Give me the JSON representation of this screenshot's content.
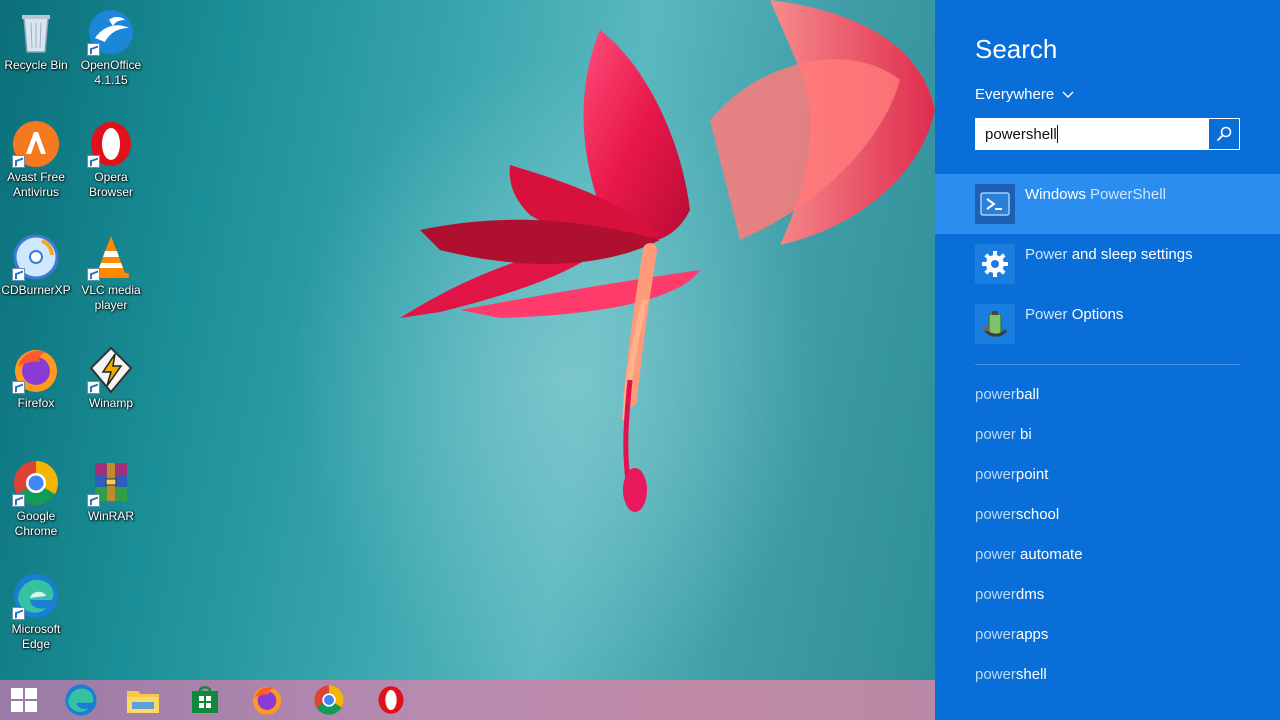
{
  "desktop": {
    "icons": [
      {
        "label_1": "Recycle Bin",
        "label_2": "",
        "icon": "recycle-bin-icon"
      },
      {
        "label_1": "OpenOffice",
        "label_2": "4.1.15",
        "icon": "openoffice-icon"
      },
      {
        "label_1": "Avast Free",
        "label_2": "Antivirus",
        "icon": "avast-icon"
      },
      {
        "label_1": "Opera",
        "label_2": "Browser",
        "icon": "opera-icon"
      },
      {
        "label_1": "CDBurnerXP",
        "label_2": "",
        "icon": "cdburnerxp-icon"
      },
      {
        "label_1": "VLC media",
        "label_2": "player",
        "icon": "vlc-icon"
      },
      {
        "label_1": "Firefox",
        "label_2": "",
        "icon": "firefox-icon"
      },
      {
        "label_1": "Winamp",
        "label_2": "",
        "icon": "winamp-icon"
      },
      {
        "label_1": "Google",
        "label_2": "Chrome",
        "icon": "chrome-icon"
      },
      {
        "label_1": "WinRAR",
        "label_2": "",
        "icon": "winrar-icon"
      },
      {
        "label_1": "Microsoft",
        "label_2": "Edge",
        "icon": "edge-icon"
      }
    ]
  },
  "taskbar": {
    "items": [
      "start-icon",
      "edge-icon",
      "file-explorer-icon",
      "store-icon",
      "firefox-icon",
      "chrome-icon",
      "opera-icon"
    ]
  },
  "search": {
    "title": "Search",
    "scope": "Everywhere",
    "query": "powershell",
    "results": [
      {
        "prefix": "Windows ",
        "match": "PowerShell",
        "suffix": "",
        "icon": "powershell-icon",
        "selected": true
      },
      {
        "prefix": "",
        "match": "Power",
        "suffix": " and sleep settings",
        "icon": "gear-icon",
        "selected": false
      },
      {
        "prefix": "",
        "match": "Power",
        "suffix": " Options",
        "icon": "power-options-icon",
        "selected": false
      }
    ],
    "suggestions": [
      {
        "match": "power",
        "rest": "ball"
      },
      {
        "match": "power",
        "rest": " bi"
      },
      {
        "match": "power",
        "rest": "point"
      },
      {
        "match": "power",
        "rest": "school"
      },
      {
        "match": "power",
        "rest": " automate"
      },
      {
        "match": "power",
        "rest": "dms"
      },
      {
        "match": "power",
        "rest": "apps"
      },
      {
        "match": "power",
        "rest": "shell"
      }
    ]
  },
  "colors": {
    "panel": "#0a6ed8",
    "selected": "#2b8df0"
  }
}
